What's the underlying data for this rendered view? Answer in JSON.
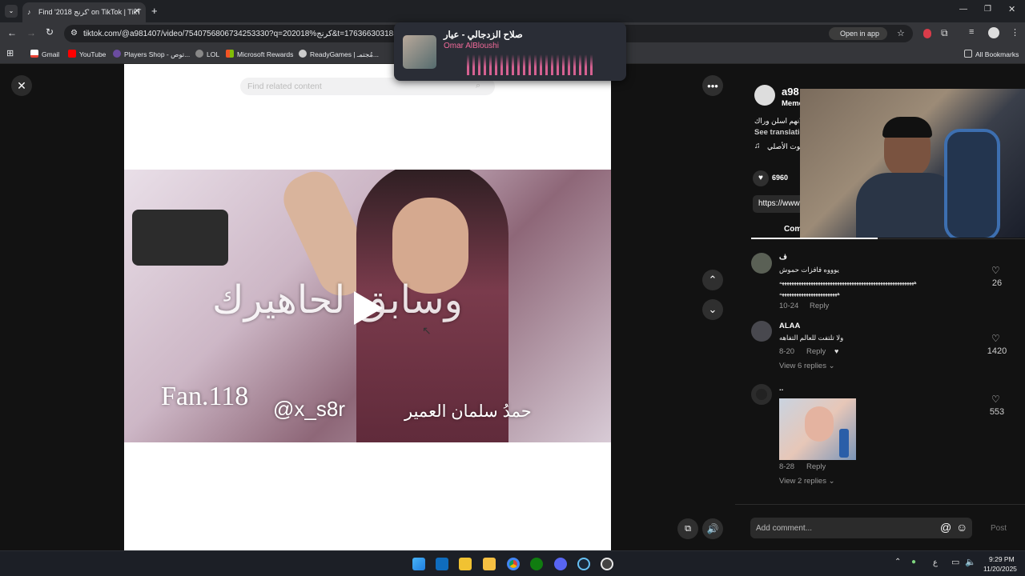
{
  "browser": {
    "tab_title": "Find '2018 كرنج' on TikTok | TikT",
    "url": "tiktok.com/@a981407/video/7540756806734253330?q=202018%كرنج&t=1763663031859",
    "open_in_app": "Open in app",
    "bookmarks": [
      "Gmail",
      "YouTube",
      "Players Shop - توص...",
      "LOL",
      "Microsoft Rewards",
      "ReadyGames | مُجتمـ...",
      "All Bookmarks"
    ]
  },
  "music_popup": {
    "title": "صلاح الزدجالي - عيار",
    "artist": "Omar AlBloushi"
  },
  "search": {
    "placeholder": "Find related content"
  },
  "video": {
    "overlay_main": "وسابق لحاهيرك",
    "watermark_left": "Fan.118",
    "watermark_handle": "@x_s8r",
    "watermark_right": "حمدُ سلمان العمير"
  },
  "author": {
    "name_partial": "a98",
    "subtitle_partial": "Meme",
    "desc_partial": "لانهم اسلن وراك",
    "see_translation": "See translation",
    "sound_partial": "صوت الأصلي",
    "likes": "6960",
    "link_partial": "https://www",
    "tab_comments": "Comments"
  },
  "comments": [
    {
      "name": "ف",
      "text": "يوووه فافزات حموش",
      "extra1": "ههههههههههههههههههههههههههههههههههههههههههههههههههههههههه",
      "extra2": "ههههههههههههههههههههههههه",
      "date": "10-24",
      "reply": "Reply",
      "likes": "26"
    },
    {
      "name": "ALAA",
      "text": "ولا تلتفت للعالم التفاهه",
      "date": "8-20",
      "reply": "Reply",
      "view_replies": "View 6 replies",
      "likes": "1420"
    },
    {
      "name": "..",
      "date": "8-28",
      "reply": "Reply",
      "view_replies": "View 2 replies",
      "likes": "553"
    }
  ],
  "comment_input": {
    "placeholder": "Add comment...",
    "post": "Post"
  },
  "taskbar": {
    "time": "9:29 PM",
    "date": "11/20/2025",
    "lang": "ع"
  }
}
